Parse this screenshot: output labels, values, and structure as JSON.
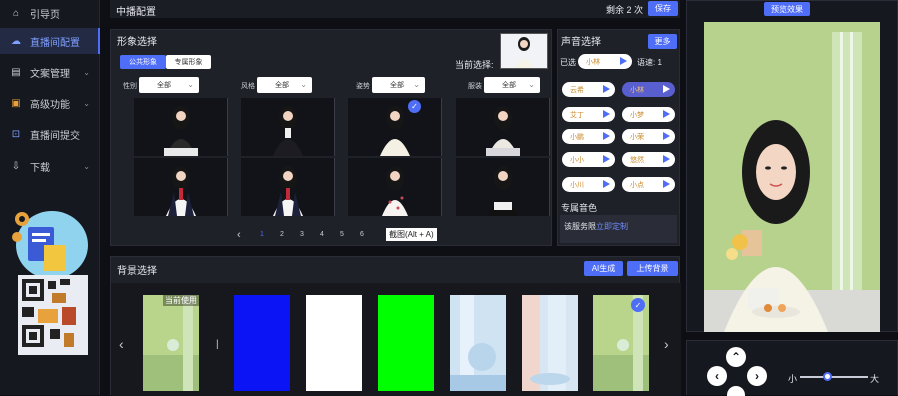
{
  "sidebar": {
    "items": [
      {
        "label": "引导页",
        "icon": "home-icon"
      },
      {
        "label": "直播间配置",
        "icon": "cloud-icon",
        "active": true
      },
      {
        "label": "文案管理",
        "icon": "document-icon",
        "caret": "⌄"
      },
      {
        "label": "高级功能",
        "icon": "grid-icon",
        "caret": "⌄"
      },
      {
        "label": "直播间提交",
        "icon": "upload-icon"
      },
      {
        "label": "下载",
        "icon": "download-icon",
        "caret": "⌄"
      }
    ]
  },
  "topbar": {
    "title": "中播配置",
    "remaining": "剩余 2 次",
    "save_label": "保存"
  },
  "avatar": {
    "section_title": "形象选择",
    "tabs": [
      "公共形象",
      "专属形象"
    ],
    "current_label": "当前选择:",
    "filters": [
      {
        "label": "性别",
        "value": "全部"
      },
      {
        "label": "风格",
        "value": "全部"
      },
      {
        "label": "姿势",
        "value": "全部"
      },
      {
        "label": "服装",
        "value": "全部"
      }
    ],
    "pagination": {
      "prev": "‹",
      "pages": [
        "1",
        "2",
        "3",
        "4",
        "5",
        "6"
      ],
      "current": "1"
    },
    "screenshot_hint": "截图(Alt + A)"
  },
  "voice": {
    "section_title": "声音选择",
    "more_label": "更多",
    "selected_label": "已选",
    "selected_value": "小林",
    "speed_label": "语速: 1",
    "options": [
      "云希",
      "小林",
      "艾丁",
      "小梦",
      "小鹏",
      "小荣",
      "小小",
      "悠然",
      "小川",
      "小点"
    ],
    "custom_title": "专属音色",
    "custom_text": "该服务限",
    "custom_link": "立即定制"
  },
  "background": {
    "section_title": "背景选择",
    "ai_label": "AI生成",
    "upload_label": "上传背景",
    "in_use_label": "当前使用",
    "divider": "|",
    "prev": "‹",
    "next": "›"
  },
  "preview": {
    "preview_label": "预览效果",
    "size_small": "小",
    "size_large": "大",
    "size_value": 0.05
  },
  "colors": {
    "accent": "#4f6ef7",
    "panel": "#1f2129",
    "bg_blue": "#0a14f5",
    "bg_white": "#ffffff",
    "bg_green": "#00ff00"
  }
}
